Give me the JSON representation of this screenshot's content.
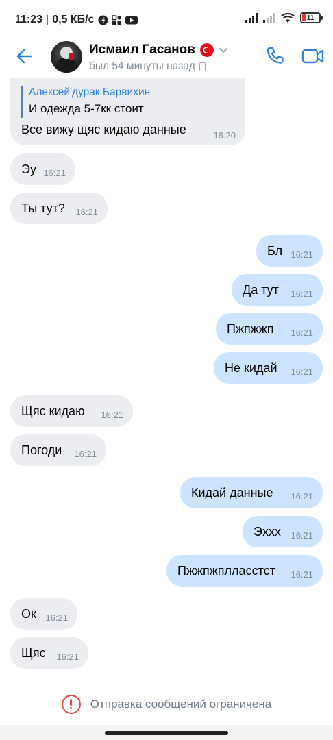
{
  "status_bar": {
    "time": "11:23",
    "separator": "|",
    "net_speed": "0,5 КБ/с",
    "battery_level": "11",
    "icons": [
      "facebook-icon",
      "grid-app-icon",
      "youtube-icon",
      "signal-icon",
      "signal-icon",
      "wifi-icon",
      "battery-icon"
    ]
  },
  "header": {
    "contact_name": "Исмаил Гасанов",
    "last_seen": "был 54 минуты назад",
    "icons": [
      "back-arrow-icon",
      "turkey-flag-icon",
      "chevron-down-icon",
      "mobile-device-icon",
      "phone-icon",
      "video-camera-icon"
    ],
    "accent_color": "#2d81e0"
  },
  "reply": {
    "author": "Алексей'дурак Барвихин",
    "quoted_text": "И одежда 5-7кк стоит",
    "text": "Все вижу щяс кидаю данные",
    "time": "16:20"
  },
  "messages": [
    {
      "dir": "in",
      "text": "Эу",
      "time": "16:21"
    },
    {
      "dir": "in",
      "text": "Ты тут?",
      "time": "16:21"
    },
    {
      "dir": "out",
      "text": "Бл",
      "time": "16:21"
    },
    {
      "dir": "out",
      "text": "Да тут",
      "time": "16:21"
    },
    {
      "dir": "out",
      "text": "Пжпжжп",
      "time": "16:21"
    },
    {
      "dir": "out",
      "text": "Не кидай",
      "time": "16:21"
    },
    {
      "dir": "in",
      "text": "Щяс кидаю",
      "time": "16:21"
    },
    {
      "dir": "in",
      "text": "Погоди",
      "time": "16:21"
    },
    {
      "dir": "out",
      "text": "Кидай данные",
      "time": "16:21"
    },
    {
      "dir": "out",
      "text": "Эххх",
      "time": "16:21"
    },
    {
      "dir": "out",
      "text": "Пжжпжплласстст",
      "time": "16:21"
    },
    {
      "dir": "in",
      "text": "Ок",
      "time": "16:21"
    },
    {
      "dir": "in",
      "text": "Щяс",
      "time": "16:21"
    }
  ],
  "footer": {
    "notice": "Отправка сообщений ограничена",
    "icon": "warning-circle-icon",
    "warning_color": "#e64646"
  },
  "colors": {
    "incoming_bubble": "#ebedf0",
    "outgoing_bubble": "#cce4ff",
    "time_text": "#818c99"
  }
}
